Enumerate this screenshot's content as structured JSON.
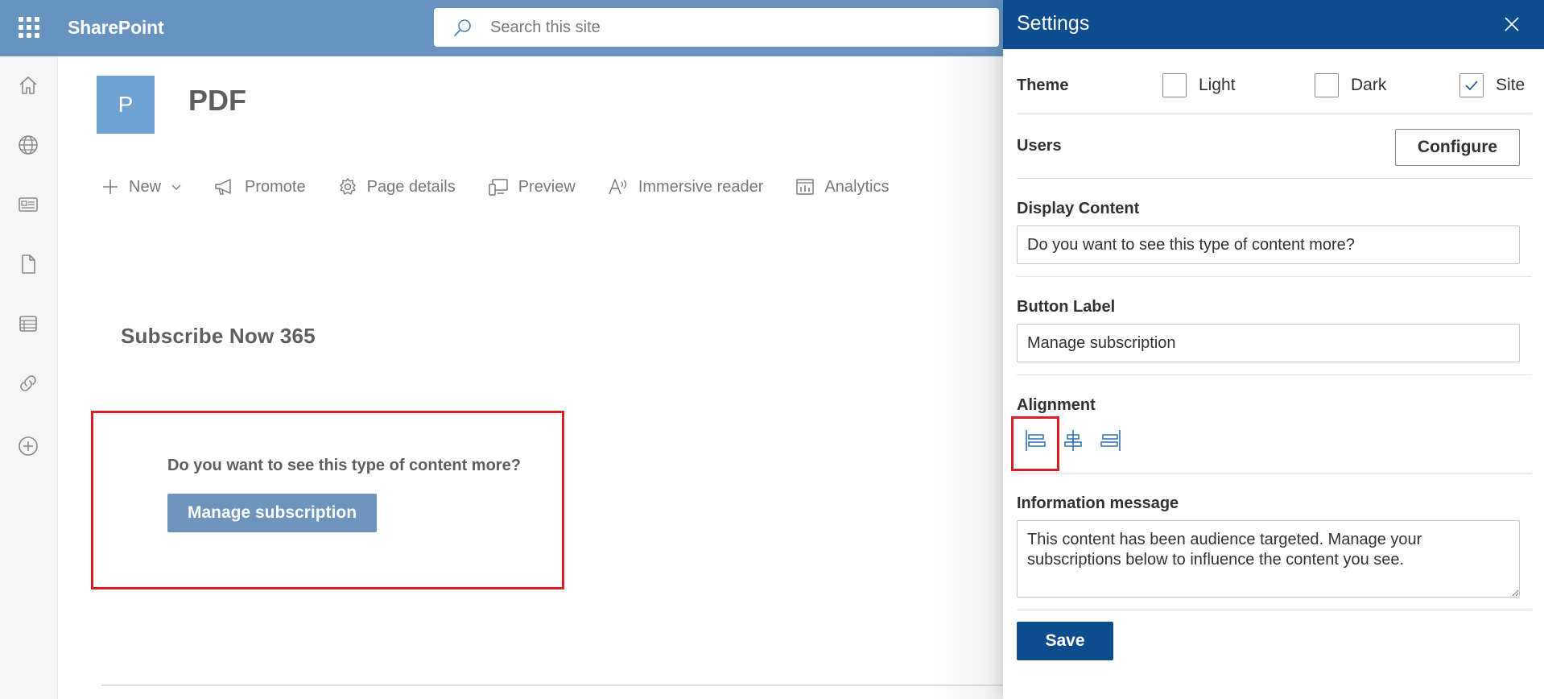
{
  "suite": {
    "app_name": "SharePoint",
    "search_placeholder": "Search this site",
    "brand_color": "#6693bf"
  },
  "rail": {
    "icons": [
      "home-icon",
      "globe-icon",
      "news-icon",
      "document-icon",
      "list-icon",
      "link-icon",
      "add-circle-icon"
    ]
  },
  "site": {
    "logo_letter": "P",
    "title": "PDF"
  },
  "command_bar": {
    "new": "New",
    "promote": "Promote",
    "page_details": "Page details",
    "preview": "Preview",
    "immersive_reader": "Immersive reader",
    "analytics": "Analytics"
  },
  "content": {
    "section_title": "Subscribe Now 365",
    "webpart_question": "Do you want to see this type of content more?",
    "webpart_button": "Manage subscription"
  },
  "settings": {
    "title": "Settings",
    "theme_label": "Theme",
    "theme_options": [
      {
        "label": "Light",
        "checked": false
      },
      {
        "label": "Dark",
        "checked": false
      },
      {
        "label": "Site",
        "checked": true
      }
    ],
    "users_label": "Users",
    "configure_label": "Configure",
    "display_content_label": "Display Content",
    "display_content_value": "Do you want to see this type of content more?",
    "button_label_label": "Button Label",
    "button_label_value": "Manage subscription",
    "alignment_label": "Alignment",
    "alignment_selected": "left",
    "information_label": "Information message",
    "information_value": "This content has been audience targeted. Manage your subscriptions below to influence the content you see.",
    "save_label": "Save",
    "header_color": "#0d4c8d",
    "highlight_color": "#d61f26"
  }
}
